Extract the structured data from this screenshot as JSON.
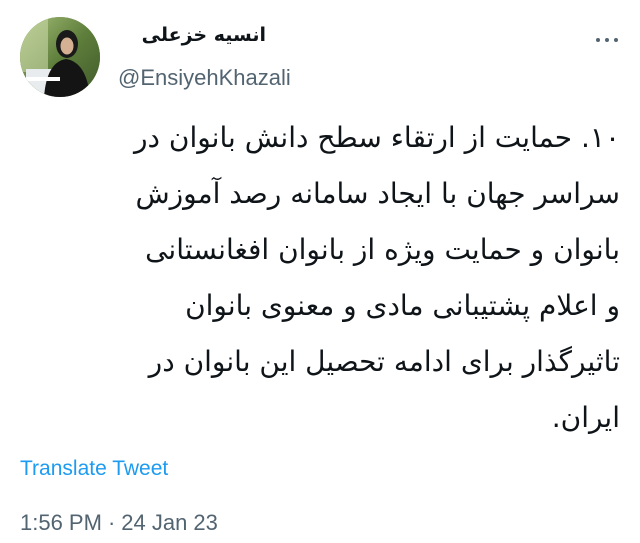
{
  "author": {
    "display_name": "انسیه خزعلی",
    "handle": "@EnsiyehKhazali"
  },
  "tweet": {
    "lines": [
      "۱۰. حمایت از ارتقاء سطح دانش بانوان در",
      "سراسر جهان با ایجاد سامانه رصد آموزش",
      "بانوان و حمایت ویژه از بانوان افغانستانی",
      "و اعلام پشتیبانی مادی و معنوی بانوان",
      "تاثیرگذار برای ادامه تحصیل این بانوان در",
      "ایران."
    ],
    "translate_label": "Translate Tweet",
    "time": "1:56 PM",
    "separator": "·",
    "date": "24 Jan 23"
  },
  "icons": {
    "more": "more-horizontal-icon",
    "avatar": "profile-photo"
  },
  "colors": {
    "text_primary": "#0f1419",
    "text_secondary": "#536471",
    "link": "#1d9bf0",
    "background": "#ffffff"
  }
}
